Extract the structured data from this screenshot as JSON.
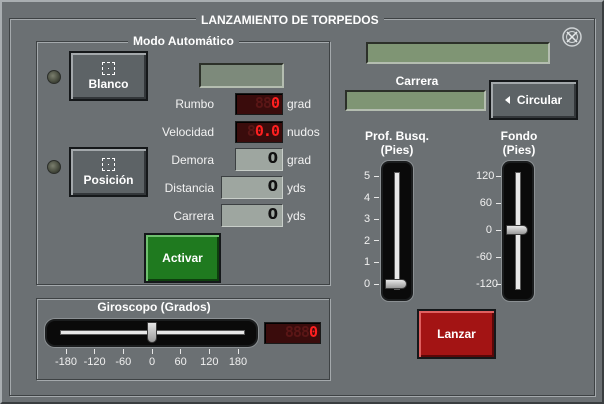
{
  "title": "LANZAMIENTO DE TORPEDOS",
  "close_icon": "close-x-circle-icon",
  "auto_mode": {
    "title": "Modo Automático",
    "target_button_label": "Blanco",
    "position_button_label": "Posición",
    "target_icon": "crosshair-reticle-icon",
    "position_icon": "crosshair-reticle-icon",
    "fields": [
      {
        "label": "Rumbo",
        "value": "0",
        "ghost": "88",
        "unit": "grad"
      },
      {
        "label": "Velocidad",
        "value": "0.0",
        "ghost": "8",
        "unit": "nudos"
      },
      {
        "label": "Demora",
        "value": "0",
        "unit": "grad"
      },
      {
        "label": "Distancia",
        "value": "0",
        "unit": "yds"
      },
      {
        "label": "Carrera",
        "value": "0",
        "unit": "yds"
      }
    ],
    "activate_label": "Activar"
  },
  "run": {
    "label": "Carrera",
    "circular_label": "Circular",
    "circular_icon": "triangle-left-icon"
  },
  "search_depth": {
    "label_line1": "Prof. Busq.",
    "label_line2": "(Pies)",
    "ticks": [
      "5",
      "4",
      "3",
      "2",
      "1",
      "0"
    ],
    "value": 0
  },
  "bottom": {
    "label_line1": "Fondo",
    "label_line2": "(Pies)",
    "ticks": [
      "120",
      "60",
      "0",
      "-60",
      "-120"
    ],
    "value": 0
  },
  "gyro": {
    "title": "Giroscopo (Grados)",
    "ticks": [
      "-180",
      "-120",
      "-60",
      "0",
      "60",
      "120",
      "180"
    ],
    "value": 0,
    "readout": "0",
    "readout_ghost": "888"
  },
  "launch_label": "Lanzar",
  "colors": {
    "panel": "#6b7073",
    "activate_green": "#1f7a1f",
    "launch_red": "#a31414",
    "led_red": "#ff2020",
    "lcd_green": "#7f9574"
  }
}
